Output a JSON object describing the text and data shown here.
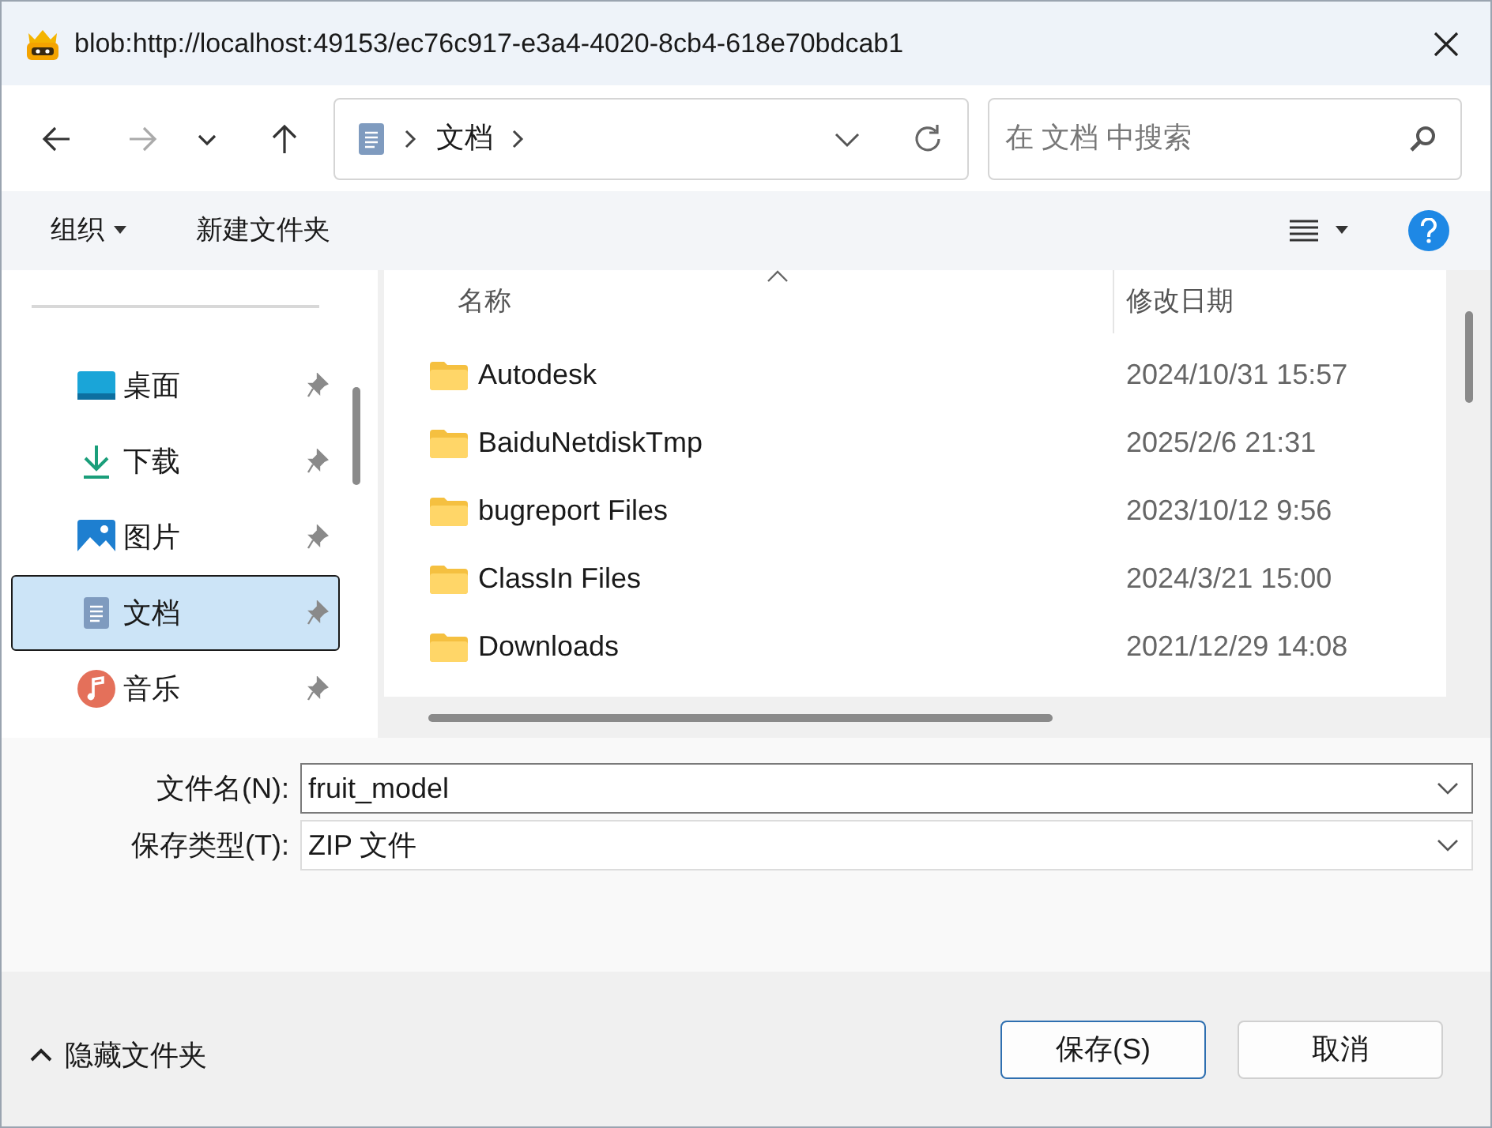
{
  "window": {
    "title": "blob:http://localhost:49153/ec76c917-e3a4-4020-8cb4-618e70bdcab1"
  },
  "address": {
    "path": [
      "文档"
    ],
    "search_placeholder": "在 文档 中搜索"
  },
  "toolbar": {
    "organize": "组织",
    "new_folder": "新建文件夹"
  },
  "sidebar": {
    "items": [
      {
        "kind": "desktop",
        "label": "桌面",
        "selected": false
      },
      {
        "kind": "download",
        "label": "下载",
        "selected": false
      },
      {
        "kind": "pictures",
        "label": "图片",
        "selected": false
      },
      {
        "kind": "documents",
        "label": "文档",
        "selected": true
      },
      {
        "kind": "music",
        "label": "音乐",
        "selected": false
      }
    ]
  },
  "table": {
    "columns": [
      "名称",
      "修改日期"
    ],
    "rows": [
      {
        "name": "Autodesk",
        "date": "2024/10/31 15:57"
      },
      {
        "name": "BaiduNetdiskTmp",
        "date": "2025/2/6 21:31"
      },
      {
        "name": "bugreport Files",
        "date": "2023/10/12 9:56"
      },
      {
        "name": "ClassIn Files",
        "date": "2024/3/21 15:00"
      },
      {
        "name": "Downloads",
        "date": "2021/12/29 14:08"
      }
    ]
  },
  "form": {
    "filename_label": "文件名(N):",
    "filename": "fruit_model",
    "type_label": "保存类型(T):",
    "type": "ZIP 文件"
  },
  "footer": {
    "hide_folders": "隐藏文件夹",
    "buttons": [
      {
        "label": "保存(S)",
        "default": true
      },
      {
        "label": "取消",
        "default": false
      }
    ]
  }
}
